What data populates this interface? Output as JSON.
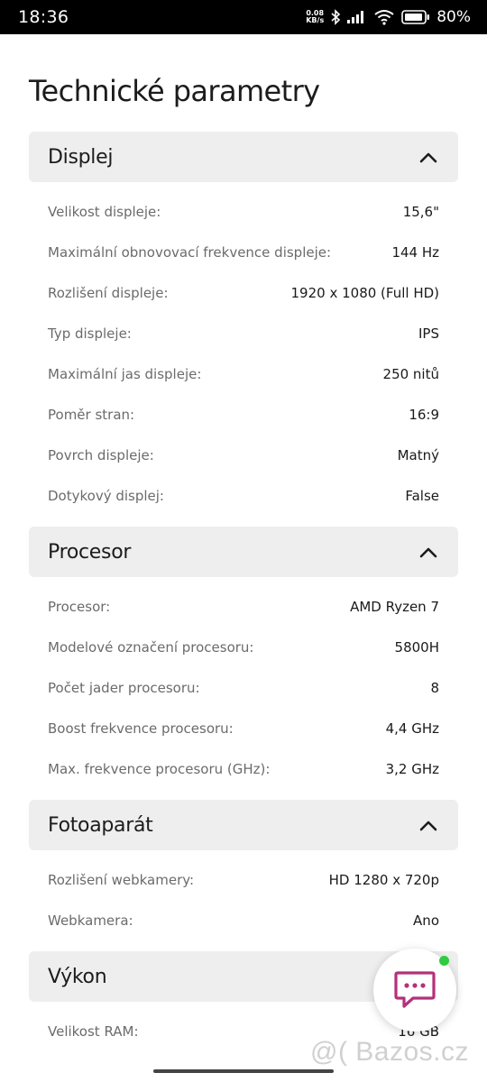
{
  "status_bar": {
    "time": "18:36",
    "net_speed_value": "0.08",
    "net_speed_unit": "KB/s",
    "battery": "80%"
  },
  "page_title": "Technické parametry",
  "sections": [
    {
      "title": "Displej",
      "rows": [
        {
          "label": "Velikost displeje:",
          "value": "15,6\""
        },
        {
          "label": "Maximální obnovovací frekvence displeje:",
          "value": "144 Hz"
        },
        {
          "label": "Rozlišení displeje:",
          "value": "1920 x 1080 (Full HD)"
        },
        {
          "label": "Typ displeje:",
          "value": "IPS"
        },
        {
          "label": "Maximální jas displeje:",
          "value": "250 nitů"
        },
        {
          "label": "Poměr stran:",
          "value": "16:9"
        },
        {
          "label": "Povrch displeje:",
          "value": "Matný"
        },
        {
          "label": "Dotykový displej:",
          "value": "False"
        }
      ]
    },
    {
      "title": "Procesor",
      "rows": [
        {
          "label": "Procesor:",
          "value": "AMD Ryzen 7"
        },
        {
          "label": "Modelové označení procesoru:",
          "value": "5800H"
        },
        {
          "label": "Počet jader procesoru:",
          "value": "8"
        },
        {
          "label": "Boost frekvence procesoru:",
          "value": "4,4 GHz"
        },
        {
          "label": "Max. frekvence procesoru (GHz):",
          "value": "3,2 GHz"
        }
      ]
    },
    {
      "title": "Fotoaparát",
      "rows": [
        {
          "label": "Rozlišení webkamery:",
          "value": "HD 1280 x 720p"
        },
        {
          "label": "Webkamera:",
          "value": "Ano"
        }
      ]
    },
    {
      "title": "Výkon",
      "rows": [
        {
          "label": "Velikost RAM:",
          "value": "16 GB"
        }
      ]
    }
  ],
  "watermark": "@( Bazos.cz",
  "colors": {
    "section_bg": "#eeeeee",
    "label": "#6b6b6b",
    "chat_icon": "#b5307a",
    "online": "#2ecc40"
  }
}
